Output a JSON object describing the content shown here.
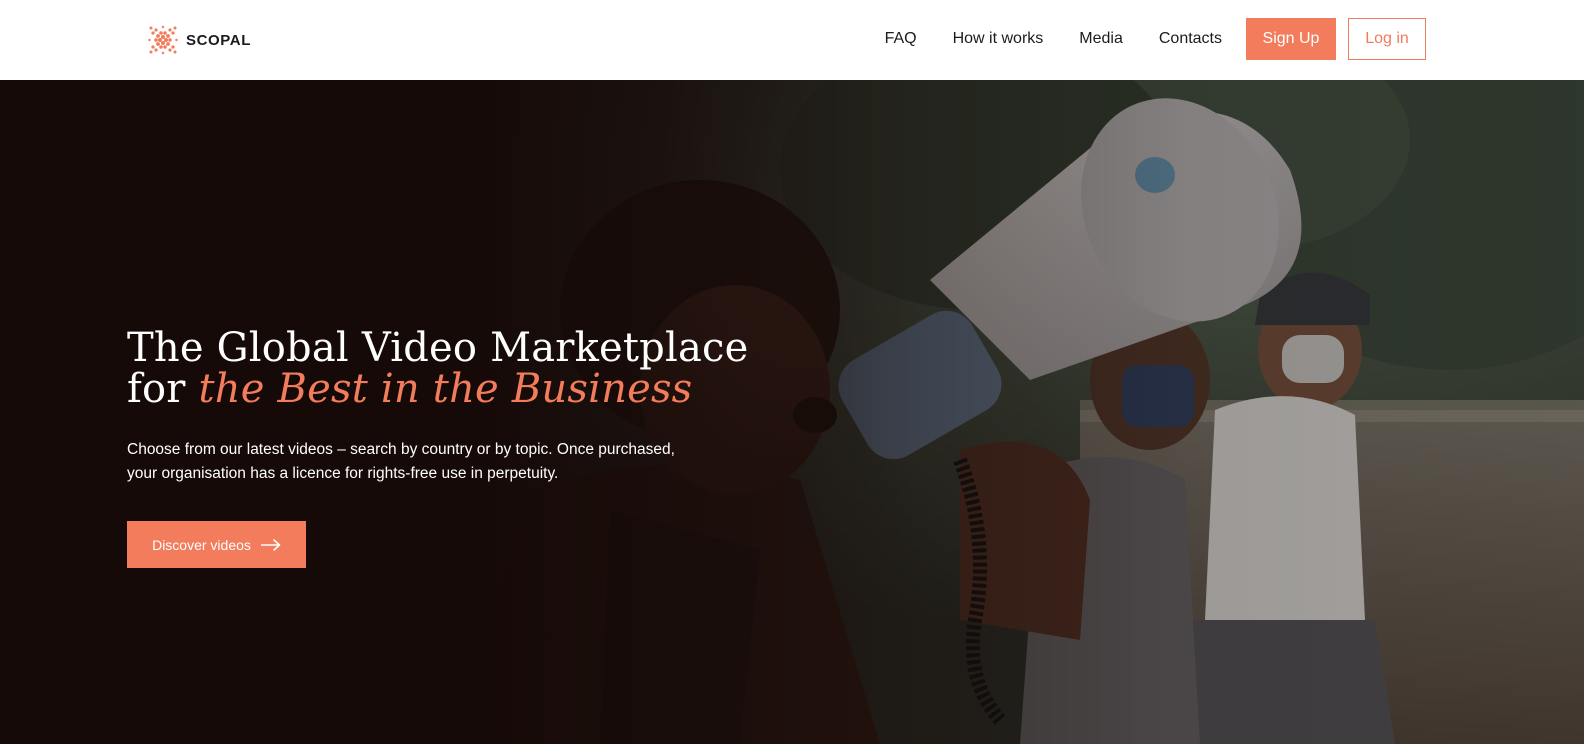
{
  "brand": {
    "name": "SCOPAL",
    "accent_color": "#f27c5b",
    "logo_icon": "scopal-logo-icon"
  },
  "nav": {
    "items": [
      {
        "label": "FAQ"
      },
      {
        "label": "How it works"
      },
      {
        "label": "Media"
      },
      {
        "label": "Contacts"
      }
    ],
    "signup_label": "Sign Up",
    "login_label": "Log in"
  },
  "hero": {
    "title_line1": "The Global Video Marketplace",
    "title_line2_prefix": "for",
    "title_line2_accent": "the Best in the Business",
    "description": "Choose from our latest videos – search by country or by topic. Once purchased, your organisation has a licence for rights-free use in perpetuity.",
    "cta_label": "Discover videos",
    "cta_icon": "arrow-right-icon",
    "background_image": "protester-with-megaphone-photo"
  }
}
